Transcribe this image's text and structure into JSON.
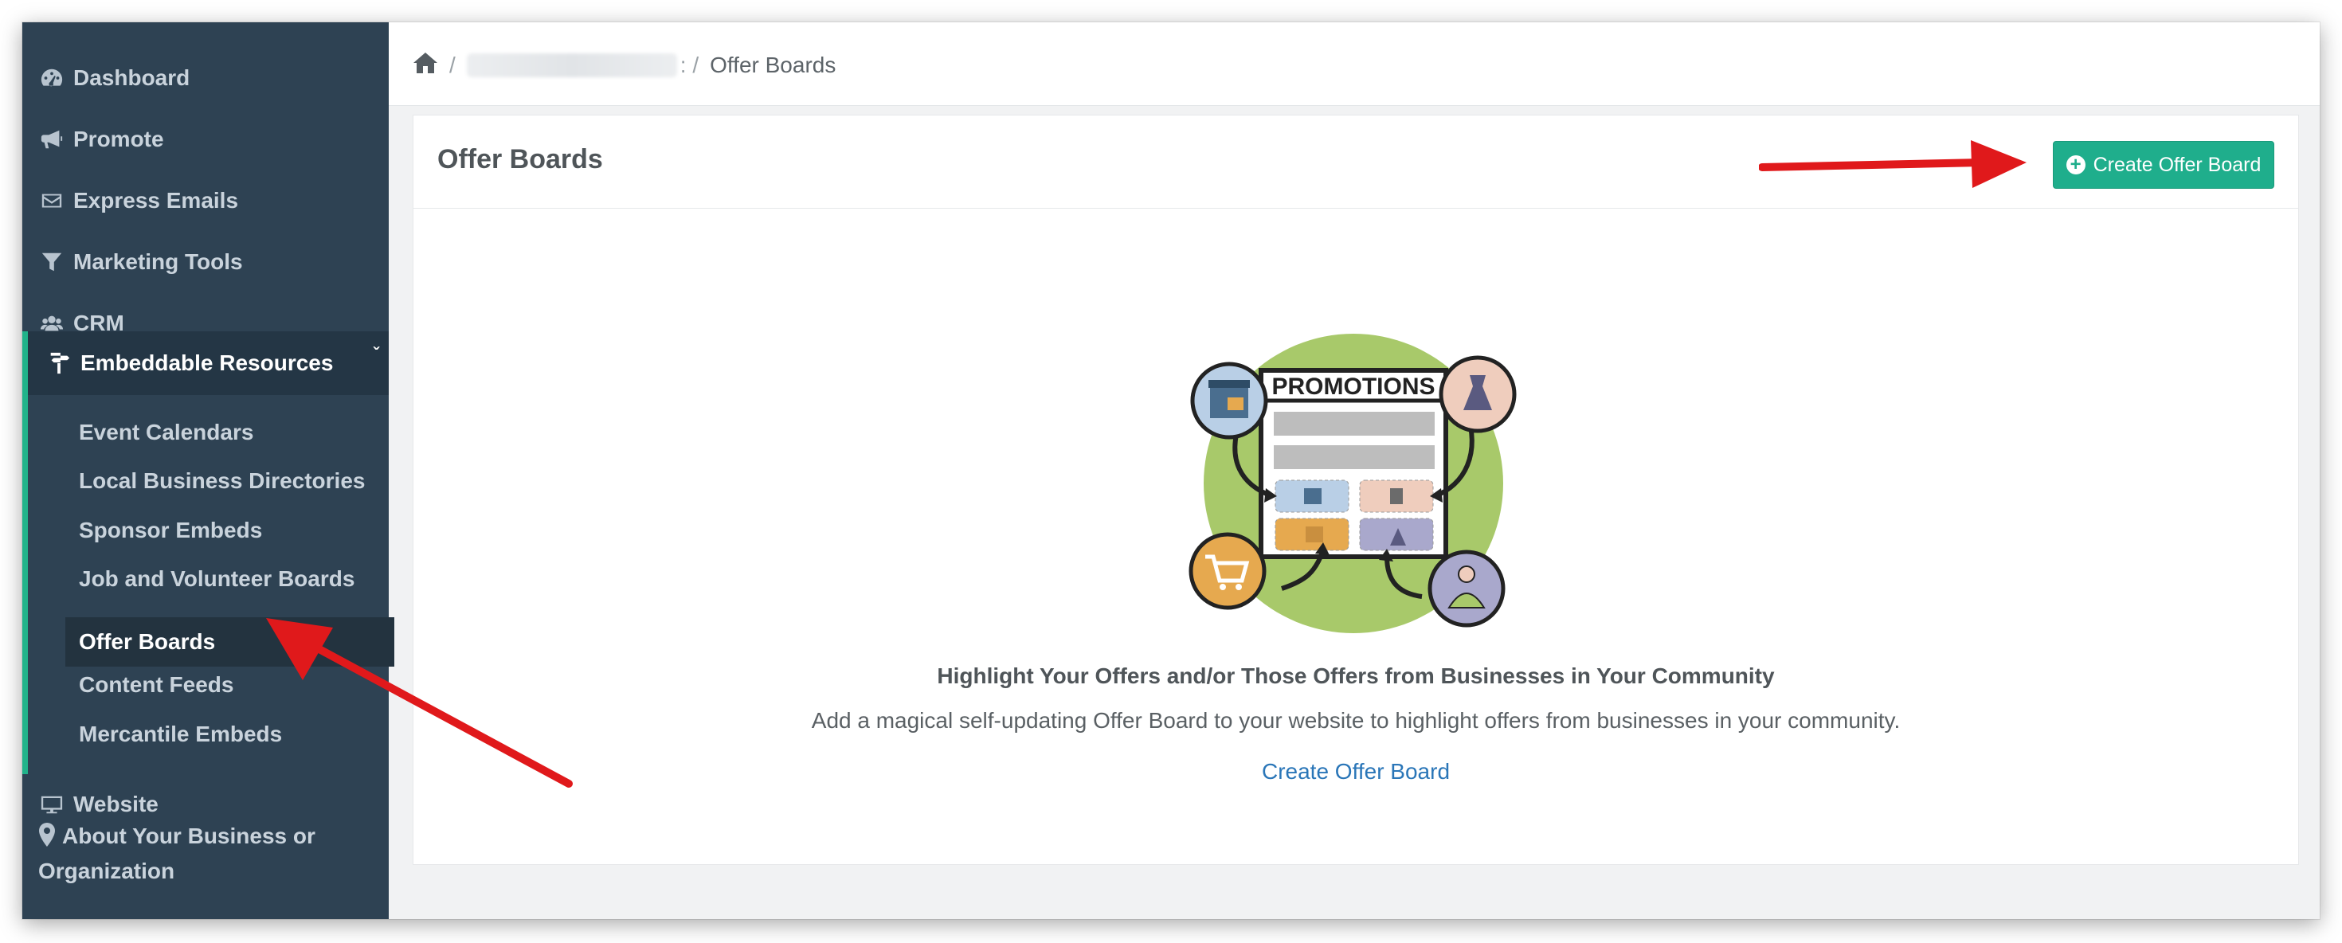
{
  "sidebar": {
    "items": [
      {
        "label": "Dashboard",
        "icon": "tachometer-icon"
      },
      {
        "label": "Promote",
        "icon": "bullhorn-icon"
      },
      {
        "label": "Express Emails",
        "icon": "envelope-icon"
      },
      {
        "label": "Marketing Tools",
        "icon": "filter-icon"
      },
      {
        "label": "CRM",
        "icon": "users-icon"
      },
      {
        "label": "Embeddable Resources",
        "icon": "signpost-icon"
      }
    ],
    "embeddable_sub": [
      "Event Calendars",
      "Local Business Directories",
      "Sponsor Embeds",
      "Job and Volunteer Boards",
      "Offer Boards",
      "Content Feeds",
      "Mercantile Embeds"
    ],
    "website": {
      "label": "Website",
      "icon": "desktop-icon"
    },
    "about": {
      "label": "About Your Business or Organization",
      "icon": "map-marker-icon"
    }
  },
  "breadcrumb": {
    "current": "Offer Boards"
  },
  "card": {
    "title": "Offer Boards",
    "button_label": "Create Offer Board",
    "illustration_text": "PROMOTIONS",
    "headline": "Highlight Your Offers and/or Those Offers from Businesses in Your Community",
    "description": "Add a magical self-updating Offer Board to your website to highlight offers from businesses in your community.",
    "link_label": "Create Offer Board"
  },
  "colors": {
    "sidebar_bg": "#2e4253",
    "accent_green": "#1fae8c",
    "link_blue": "#2a76b8",
    "annotation_red": "#e0191b"
  }
}
